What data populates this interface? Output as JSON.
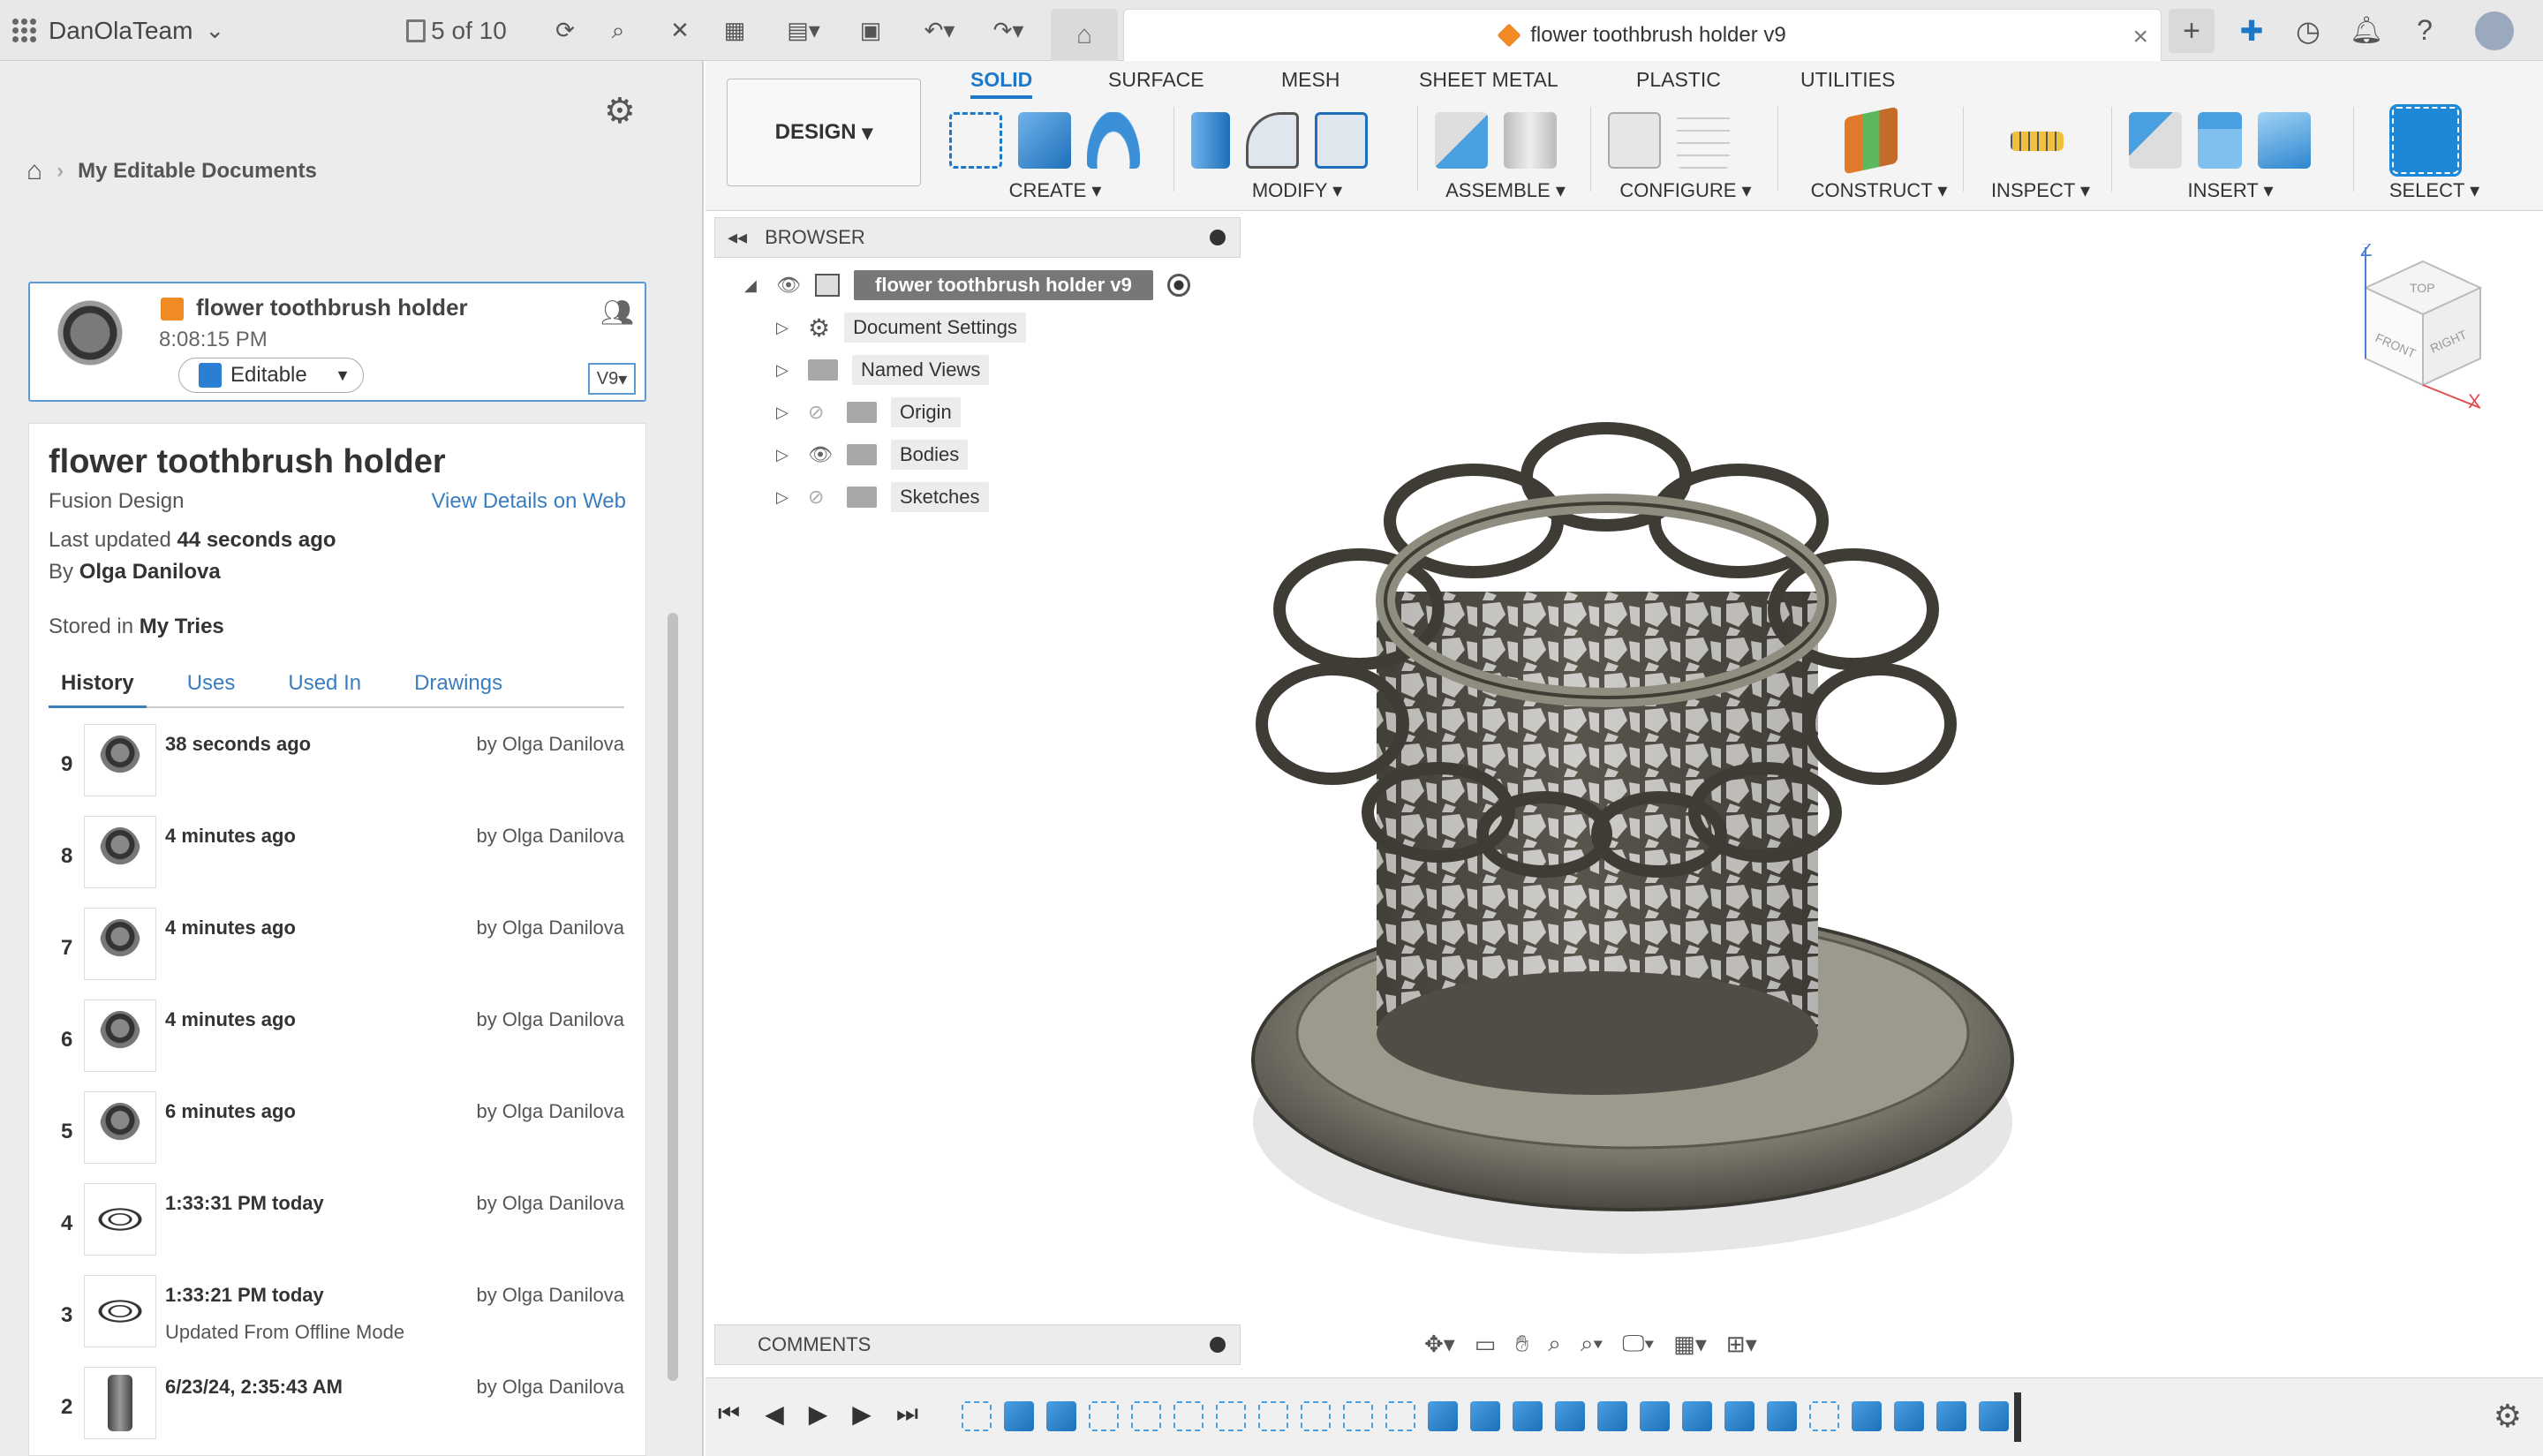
{
  "topbar": {
    "team_name": "DanOlaTeam",
    "doc_count": "5 of 10",
    "doc_tab_title": "flower toothbrush holder v9",
    "close_glyph": "×"
  },
  "data_panel": {
    "breadcrumb": "My Editable Documents",
    "card": {
      "title": "flower toothbrush holder",
      "time": "8:08:15 PM",
      "status_button": "Editable",
      "version": "V9"
    },
    "detail": {
      "title": "flower toothbrush holder",
      "type": "Fusion Design",
      "view_web_link": "View Details on Web",
      "updated_label": "Last updated ",
      "updated_value": "44 seconds ago",
      "by_label": "By ",
      "by_value": "Olga Danilova",
      "stored_label": "Stored in ",
      "stored_value": "My Tries"
    },
    "tabs": [
      "History",
      "Uses",
      "Used In",
      "Drawings"
    ],
    "history": [
      {
        "num": "9",
        "time": "38 seconds ago",
        "by": "by Olga Danilova",
        "note": "",
        "thumb": "holder"
      },
      {
        "num": "8",
        "time": "4 minutes ago",
        "by": "by Olga Danilova",
        "note": "",
        "thumb": "holder"
      },
      {
        "num": "7",
        "time": "4 minutes ago",
        "by": "by Olga Danilova",
        "note": "",
        "thumb": "holder"
      },
      {
        "num": "6",
        "time": "4 minutes ago",
        "by": "by Olga Danilova",
        "note": "",
        "thumb": "holder"
      },
      {
        "num": "5",
        "time": "6 minutes ago",
        "by": "by Olga Danilova",
        "note": "",
        "thumb": "holder"
      },
      {
        "num": "4",
        "time": "1:33:31 PM today",
        "by": "by Olga Danilova",
        "note": "",
        "thumb": "flat"
      },
      {
        "num": "3",
        "time": "1:33:21 PM today",
        "by": "by Olga Danilova",
        "note": "Updated From Offline Mode",
        "thumb": "flat"
      },
      {
        "num": "2",
        "time": "6/23/24, 2:35:43 AM",
        "by": "by Olga Danilova",
        "note": "",
        "thumb": "tube"
      }
    ]
  },
  "toolbar": {
    "workspace": "DESIGN",
    "tabs": [
      "SOLID",
      "SURFACE",
      "MESH",
      "SHEET METAL",
      "PLASTIC",
      "UTILITIES"
    ],
    "groups": [
      "CREATE",
      "MODIFY",
      "ASSEMBLE",
      "CONFIGURE",
      "CONSTRUCT",
      "INSPECT",
      "INSERT",
      "SELECT"
    ]
  },
  "browser": {
    "header": "BROWSER",
    "root": "flower toothbrush holder v9",
    "nodes": [
      "Document Settings",
      "Named Views",
      "Origin",
      "Bodies",
      "Sketches"
    ]
  },
  "comments": {
    "label": "COMMENTS"
  },
  "viewcube": {
    "top": "TOP",
    "front": "FRONT",
    "right": "RIGHT",
    "axis_z": "Z",
    "axis_x": "X"
  },
  "colors": {
    "accent": "#1e78c8",
    "orange": "#f08a24",
    "model": "#5e5b52"
  }
}
